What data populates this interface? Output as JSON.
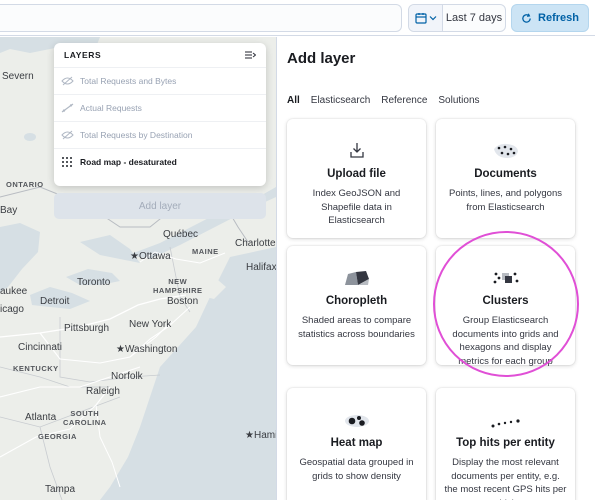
{
  "topbar": {
    "date_range": "Last 7 days",
    "refresh_label": "Refresh",
    "calendar_icon": "calendar-icon",
    "refresh_icon": "refresh-icon"
  },
  "map": {
    "labels": {
      "severn": "Severn",
      "ontario": "ONTARIO",
      "bay": "Bay",
      "quebec": "Québec",
      "maine": "MAINE",
      "charlotte": "Charlotte",
      "ottawa": "Ottawa",
      "halifax": "Halifax",
      "new_hampshire": "NEW\nHAMPSHIRE",
      "aukee": "aukee",
      "toronto": "Toronto",
      "boston": "Boston",
      "detroit": "Detroit",
      "icago": "icago",
      "pittsburgh": "Pittsburgh",
      "new_york": "New York",
      "cincinnati": "Cincinnati",
      "washington": "Washington",
      "kentucky": "KENTUCKY",
      "norfolk": "Norfolk",
      "raleigh": "Raleigh",
      "atlanta": "Atlanta",
      "south_carolina": "SOUTH\nCAROLINA",
      "georgia": "GEORGIA",
      "hami": "Hami",
      "tampa": "Tampa"
    }
  },
  "layers_panel": {
    "title": "LAYERS",
    "layers": [
      {
        "label": "Total Requests and Bytes",
        "icon": "eye-closed-icon",
        "active": false
      },
      {
        "label": "Actual Requests",
        "icon": "line-layer-icon",
        "active": false
      },
      {
        "label": "Total Requests by Destination",
        "icon": "eye-closed-icon",
        "active": false
      },
      {
        "label": "Road map - desaturated",
        "icon": "grid-tiles-icon",
        "active": true
      }
    ],
    "add_layer_label": "Add layer"
  },
  "flyout": {
    "title": "Add layer",
    "tabs": [
      "All",
      "Elasticsearch",
      "Reference",
      "Solutions"
    ],
    "cards": [
      {
        "title": "Upload file",
        "description": "Index GeoJSON and Shapefile data in Elasticsearch",
        "icon": "upload-file-icon"
      },
      {
        "title": "Documents",
        "description": "Points, lines, and polygons from Elasticsearch",
        "icon": "documents-icon"
      },
      {
        "title": "Choropleth",
        "description": "Shaded areas to compare statistics across boundaries",
        "icon": "choropleth-icon"
      },
      {
        "title": "Clusters",
        "description": "Group Elasticsearch documents into grids and hexagons and display metrics for each group",
        "icon": "clusters-icon"
      },
      {
        "title": "Heat map",
        "description": "Geospatial data grouped in grids to show density",
        "icon": "heat-map-icon"
      },
      {
        "title": "Top hits per entity",
        "description": "Display the most relevant documents per entity, e.g. the most recent GPS hits per vehicle.",
        "icon": "top-hits-icon"
      }
    ]
  },
  "colors": {
    "accent": "#0061a6",
    "refresh_bg": "#cce4f5",
    "highlight": "#e04fd6",
    "map_land": "#eceeea",
    "map_water": "#d6dfe4"
  }
}
